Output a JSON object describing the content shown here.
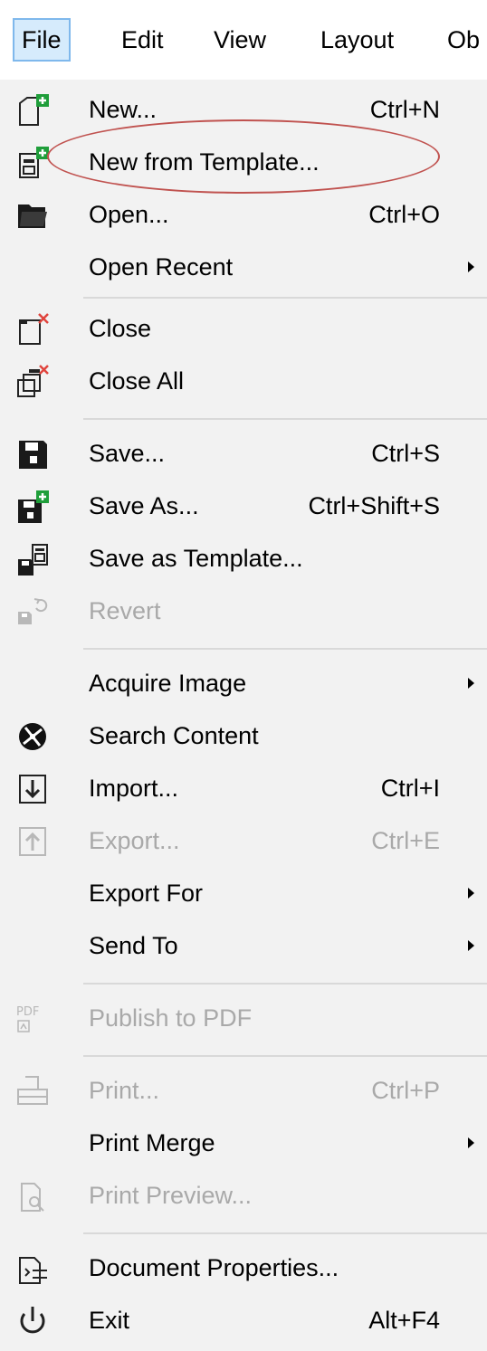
{
  "menubar": {
    "items": [
      "File",
      "Edit",
      "View",
      "Layout",
      "Ob"
    ]
  },
  "menu": {
    "items": [
      {
        "label": "New...",
        "shortcut": "Ctrl+N",
        "icon": "new-document-icon"
      },
      {
        "label": "New from Template...",
        "shortcut": "",
        "icon": "new-from-template-icon"
      },
      {
        "label": "Open...",
        "shortcut": "Ctrl+O",
        "icon": "open-folder-icon"
      },
      {
        "label": "Open Recent",
        "shortcut": "",
        "submenu": true
      },
      {
        "label": "Close",
        "shortcut": "",
        "icon": "close-document-icon"
      },
      {
        "label": "Close All",
        "shortcut": "",
        "icon": "close-all-icon"
      },
      {
        "label": "Save...",
        "shortcut": "Ctrl+S",
        "icon": "save-icon"
      },
      {
        "label": "Save As...",
        "shortcut": "Ctrl+Shift+S",
        "icon": "save-as-icon"
      },
      {
        "label": "Save as Template...",
        "shortcut": "",
        "icon": "save-as-template-icon"
      },
      {
        "label": "Revert",
        "shortcut": "",
        "icon": "revert-icon",
        "disabled": true
      },
      {
        "label": "Acquire Image",
        "shortcut": "",
        "submenu": true
      },
      {
        "label": "Search Content",
        "shortcut": "",
        "icon": "search-content-icon"
      },
      {
        "label": "Import...",
        "shortcut": "Ctrl+I",
        "icon": "import-icon"
      },
      {
        "label": "Export...",
        "shortcut": "Ctrl+E",
        "icon": "export-icon",
        "disabled": true
      },
      {
        "label": "Export For",
        "shortcut": "",
        "submenu": true
      },
      {
        "label": "Send To",
        "shortcut": "",
        "submenu": true
      },
      {
        "label": "Publish to PDF",
        "shortcut": "",
        "icon": "pdf-icon",
        "disabled": true
      },
      {
        "label": "Print...",
        "shortcut": "Ctrl+P",
        "icon": "print-icon",
        "disabled": true
      },
      {
        "label": "Print Merge",
        "shortcut": "",
        "submenu": true
      },
      {
        "label": "Print Preview...",
        "shortcut": "",
        "icon": "print-preview-icon",
        "disabled": true
      },
      {
        "label": "Document Properties...",
        "shortcut": "",
        "icon": "document-properties-icon"
      },
      {
        "label": "Exit",
        "shortcut": "Alt+F4",
        "icon": "exit-icon"
      }
    ],
    "pdf_icon_text": "PDF"
  },
  "colors": {
    "menu_bg": "#f2f2f2",
    "active_tab_bg": "#d6ebfc",
    "active_tab_border": "#7fb8ec",
    "disabled_text": "#a9a9a9",
    "highlight_ellipse": "#c0524f",
    "accent_green": "#1f9e3a",
    "accent_red": "#e0443d"
  }
}
